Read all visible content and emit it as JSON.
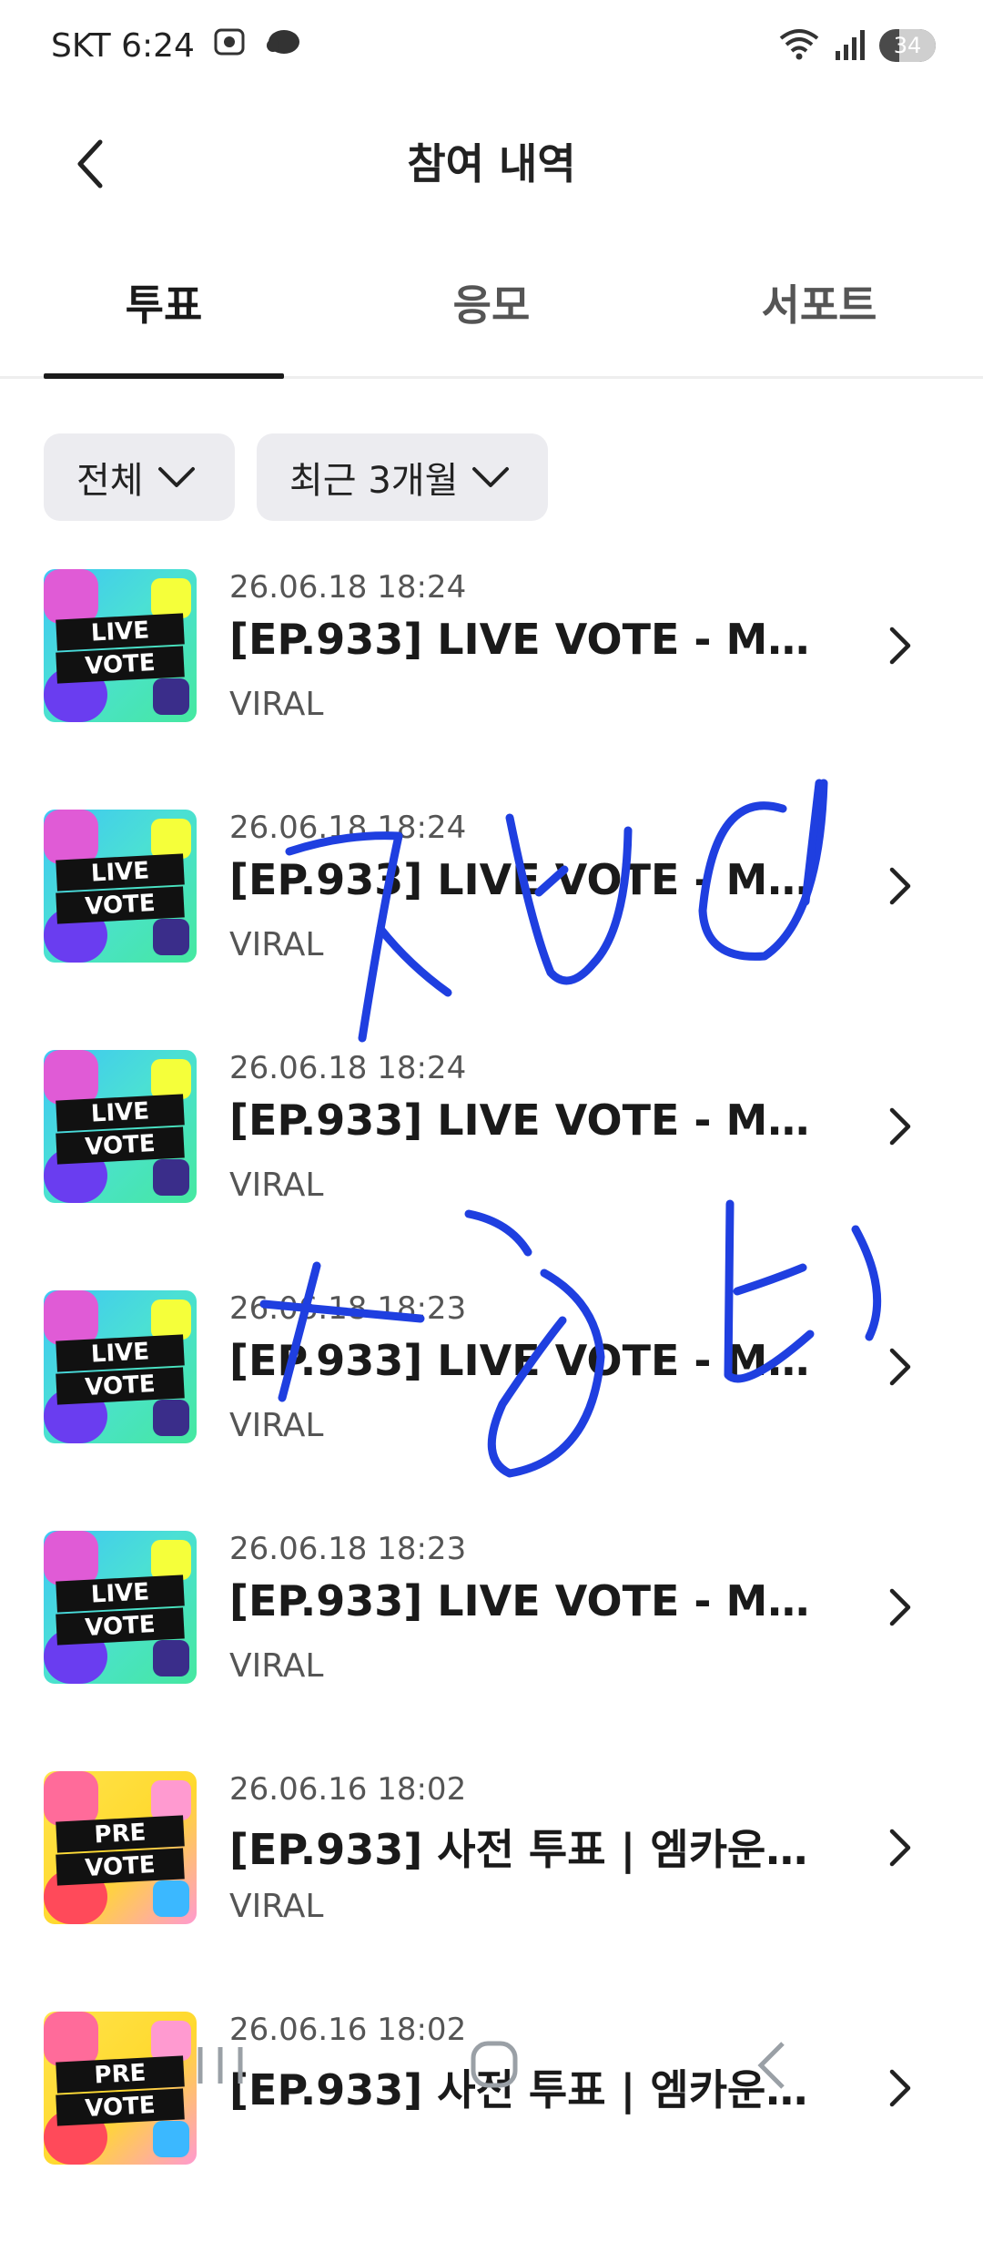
{
  "status": {
    "carrier_time": "SKT 6:24",
    "battery": "34"
  },
  "header": {
    "title": "참여 내역"
  },
  "tabs": [
    {
      "label": "투표",
      "active": true
    },
    {
      "label": "응모",
      "active": false
    },
    {
      "label": "서포트",
      "active": false
    }
  ],
  "filters": {
    "type": "전체",
    "period": "최근 3개월"
  },
  "items": [
    {
      "date": "26.06.18 18:24",
      "title": "[EP.933] LIVE VOTE - M CO...",
      "sub": "VIRAL",
      "thumb": "live",
      "badge_top": "LIVE",
      "badge_bottom": "VOTE"
    },
    {
      "date": "26.06.18 18:24",
      "title": "[EP.933] LIVE VOTE - M CO...",
      "sub": "VIRAL",
      "thumb": "live",
      "badge_top": "LIVE",
      "badge_bottom": "VOTE"
    },
    {
      "date": "26.06.18 18:24",
      "title": "[EP.933] LIVE VOTE - M CO...",
      "sub": "VIRAL",
      "thumb": "live",
      "badge_top": "LIVE",
      "badge_bottom": "VOTE"
    },
    {
      "date": "26.06.18 18:23",
      "title": "[EP.933] LIVE VOTE - M CO...",
      "sub": "VIRAL",
      "thumb": "live",
      "badge_top": "LIVE",
      "badge_bottom": "VOTE"
    },
    {
      "date": "26.06.18 18:23",
      "title": "[EP.933] LIVE VOTE - M CO...",
      "sub": "VIRAL",
      "thumb": "live",
      "badge_top": "LIVE",
      "badge_bottom": "VOTE"
    },
    {
      "date": "26.06.16 18:02",
      "title": "[EP.933] 사전 투표 | 엠카운트...",
      "sub": "VIRAL",
      "thumb": "pre",
      "badge_top": "PRE",
      "badge_bottom": "VOTE"
    },
    {
      "date": "26.06.16 18:02",
      "title": "[EP.933] 사전 투표 | 엠카운트...",
      "sub": "",
      "thumb": "pre",
      "badge_top": "PRE",
      "badge_bottom": "VOTE"
    }
  ],
  "icons": {
    "back": "chevron-left-icon",
    "row_chevron": "chevron-right-icon",
    "dropdown": "chevron-down-icon"
  },
  "colors": {
    "annotation_ink": "#1f3fe0",
    "tab_active": "#1a1a1a"
  }
}
